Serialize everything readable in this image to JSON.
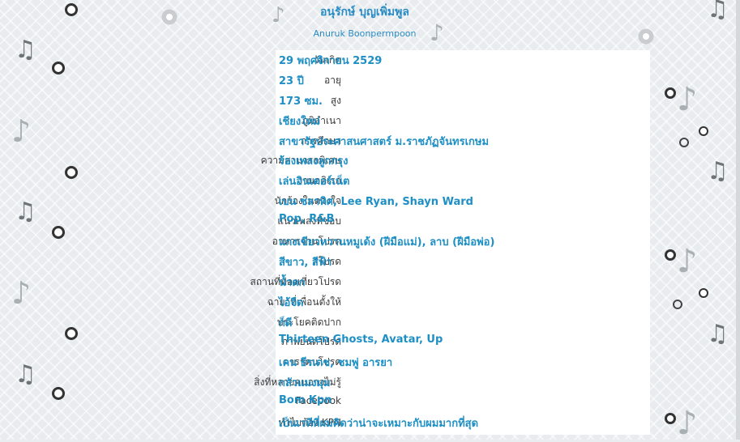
{
  "header": {
    "name_thai": "อนุรักษ์ บุญเพิ่มพูล",
    "name_english": "Anuruk Boonpermpoon"
  },
  "profile": [
    {
      "label": "วันเกิด",
      "value": "29 พฤศจิกายน 2529"
    },
    {
      "label": "อายุ",
      "value": "23 ปี"
    },
    {
      "label": "สูง",
      "value": "173 ซม."
    },
    {
      "label": "ภูมิลำเนา",
      "value": "เชียงใหม่"
    },
    {
      "label": "การศึกษา",
      "value": "สาขารัฐประศาสนศาสตร์ ม.ราชภัฏจันทรเกษม"
    },
    {
      "label": "ความสามารถพิเศษ",
      "value": "ร้องเพลงลูกกรุง"
    },
    {
      "label": "งานอดิเรก",
      "value": "เล่นอินเตอร์เน็ต"
    },
    {
      "label": "นักร้องในดวงใจ",
      "value": "เบน ชลาทิศ, Lee Ryan, Shayn Ward"
    },
    {
      "label": "แนวเพลงที่ชอบ",
      "value": "Pop, R&B"
    },
    {
      "label": "อาหารจานโปรด",
      "value": "แกงเขียวหวานหมูเด้ง (ฝีมือแม่), ลาบ (ฝีมือพ่อ)"
    },
    {
      "label": "สีโปรด",
      "value": "สีขาว, สีฟ้า"
    },
    {
      "label": "สถานที่ท่องเที่ยวโปรด",
      "value": "น้ำตก"
    },
    {
      "label": "ฉายาที่เพื่อนตั้งให้",
      "value": "ไอ้จืด"
    },
    {
      "label": "ประโยคติดปาก",
      "value": "ก็ดี"
    },
    {
      "label": "ภาพยนต์โปรด",
      "value": "Thirteen Ghosts, Avatar, Up"
    },
    {
      "label": "ดาราคนโปรด",
      "value": "เคน ธีรเดช, ชมพู่ อารยา"
    },
    {
      "label": "สิ่งที่หลายคนอาจไม่รู้",
      "value": "กลัวแมงมุม"
    },
    {
      "label": "Facebook",
      "value": "Bom Kpn"
    },
    {
      "label": "ทำไมต้อง KPN",
      "value": "เป็นเวทีที่ผมคิดว่าน่าจะเหมาะกับผมมากที่สุด"
    }
  ],
  "icons": [
    "music-note-icon",
    "speaker-ring-icon"
  ],
  "colors": {
    "value_text": "#1e8fc5",
    "label_text": "#3a3a3a",
    "background": "#e8ecef"
  }
}
